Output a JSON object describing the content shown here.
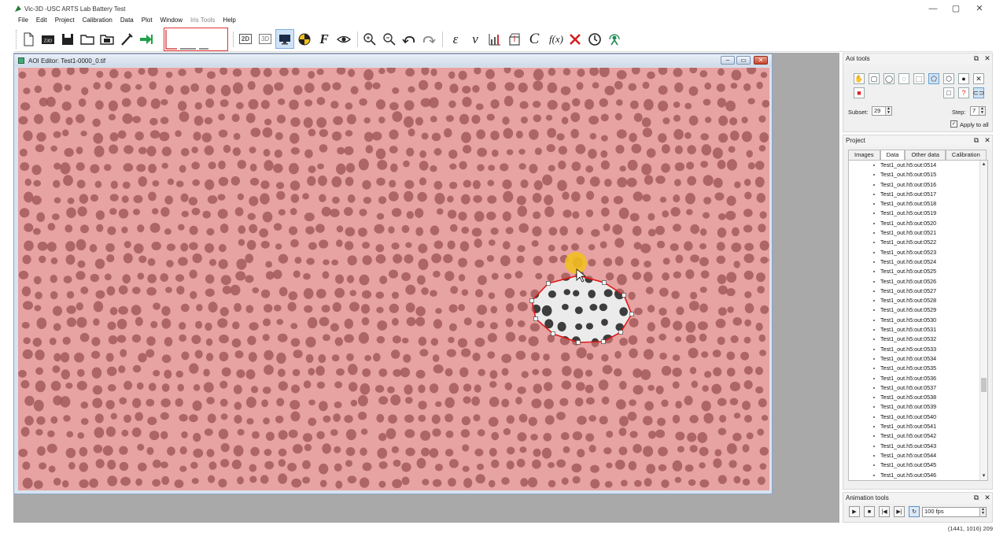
{
  "window": {
    "title": "Vic-3D -USC ARTS Lab Battery Test",
    "controls": {
      "minimize": "—",
      "maximize": "▢",
      "close": "✕"
    }
  },
  "menu": [
    "File",
    "Edit",
    "Project",
    "Calibration",
    "Data",
    "Plot",
    "Window",
    "Iris Tools",
    "Help"
  ],
  "toolbar": {
    "btn_2d": "2D",
    "btn_3d": "3D",
    "epsilon": "ε",
    "nu": "ν",
    "c": "C",
    "fx": "f(x)",
    "f": "F"
  },
  "aoi_editor": {
    "title": "AOI Editor: Test1-0000_0.tif",
    "overlay_color": "#e89c9c"
  },
  "aoi_tools": {
    "header": "Aoi tools",
    "subset_label": "Subset:",
    "subset_value": "29",
    "step_label": "Step:",
    "step_value": "7",
    "apply_all_label": "Apply to all",
    "apply_all_checked": true,
    "help_glyph": "?"
  },
  "project": {
    "header": "Project",
    "tabs": [
      "Images",
      "Data",
      "Other data",
      "Calibration"
    ],
    "selected_tab": "Data",
    "items": [
      "Test1_out.h5:out:0514",
      "Test1_out.h5:out:0515",
      "Test1_out.h5:out:0516",
      "Test1_out.h5:out:0517",
      "Test1_out.h5:out:0518",
      "Test1_out.h5:out:0519",
      "Test1_out.h5:out:0520",
      "Test1_out.h5:out:0521",
      "Test1_out.h5:out:0522",
      "Test1_out.h5:out:0523",
      "Test1_out.h5:out:0524",
      "Test1_out.h5:out:0525",
      "Test1_out.h5:out:0526",
      "Test1_out.h5:out:0527",
      "Test1_out.h5:out:0528",
      "Test1_out.h5:out:0529",
      "Test1_out.h5:out:0530",
      "Test1_out.h5:out:0531",
      "Test1_out.h5:out:0532",
      "Test1_out.h5:out:0533",
      "Test1_out.h5:out:0534",
      "Test1_out.h5:out:0535",
      "Test1_out.h5:out:0536",
      "Test1_out.h5:out:0537",
      "Test1_out.h5:out:0538",
      "Test1_out.h5:out:0539",
      "Test1_out.h5:out:0540",
      "Test1_out.h5:out:0541",
      "Test1_out.h5:out:0542",
      "Test1_out.h5:out:0543",
      "Test1_out.h5:out:0544",
      "Test1_out.h5:out:0545",
      "Test1_out.h5:out:0546"
    ]
  },
  "animation": {
    "header": "Animation tools",
    "fps": "100 fps"
  },
  "status": {
    "coords": "(1441, 1016) 209"
  }
}
